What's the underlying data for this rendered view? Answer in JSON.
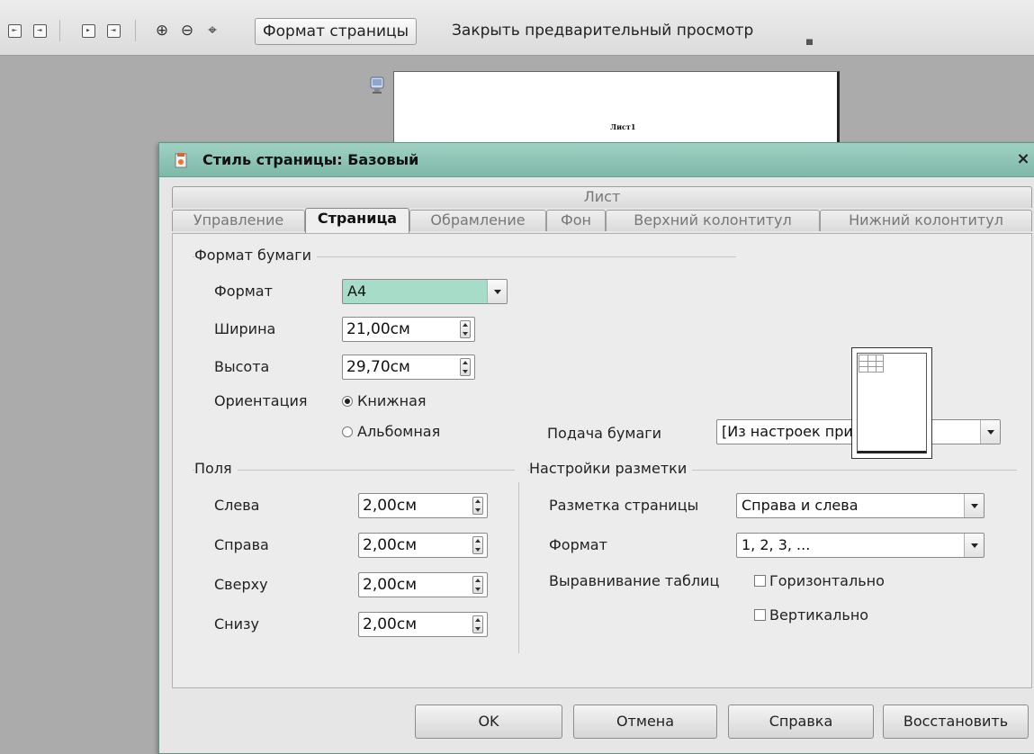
{
  "toolbar": {
    "page_format_button": "Формат страницы",
    "close_preview_button": "Закрыть предварительный просмотр"
  },
  "preview": {
    "sheet_label": "Лист1"
  },
  "dialog": {
    "title": "Стиль страницы: Базовый",
    "tab_group": "Лист",
    "tabs": [
      "Управление",
      "Страница",
      "Обрамление",
      "Фон",
      "Верхний колонтитул",
      "Нижний колонтитул"
    ],
    "active_tab": "Страница",
    "paper_format": {
      "group_label": "Формат бумаги",
      "format_label": "Формат",
      "format_value": "A4",
      "width_label": "Ширина",
      "width_value": "21,00см",
      "height_label": "Высота",
      "height_value": "29,70см",
      "orientation_label": "Ориентация",
      "portrait_label": "Книжная",
      "landscape_label": "Альбомная",
      "orientation_selected": "portrait",
      "paper_tray_label": "Подача бумаги",
      "paper_tray_value": "[Из настроек принтера]"
    },
    "margins": {
      "group_label": "Поля",
      "left_label": "Слева",
      "left_value": "2,00см",
      "right_label": "Справа",
      "right_value": "2,00см",
      "top_label": "Сверху",
      "top_value": "2,00см",
      "bottom_label": "Снизу",
      "bottom_value": "2,00см"
    },
    "layout": {
      "group_label": "Настройки разметки",
      "page_layout_label": "Разметка страницы",
      "page_layout_value": "Справа и слева",
      "numbering_label": "Формат",
      "numbering_value": "1, 2, 3, ...",
      "table_align_label": "Выравнивание таблиц",
      "horizontal_label": "Горизонтально",
      "vertical_label": "Вертикально"
    },
    "buttons": {
      "ok": "OK",
      "cancel": "Отмена",
      "help": "Справка",
      "reset": "Восстановить"
    }
  },
  "colors": {
    "titlebar": "#8fc6b7",
    "highlight": "#a6dcc8"
  }
}
